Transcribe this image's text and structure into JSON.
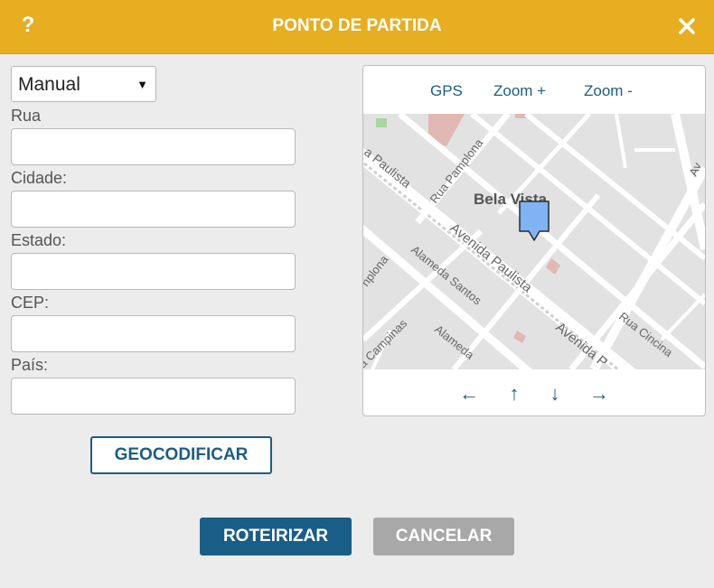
{
  "dialog": {
    "title": "PONTO DE PARTIDA",
    "help_symbol": "?"
  },
  "form": {
    "mode_select": {
      "value": "Manual"
    },
    "fields": {
      "street": {
        "label": "Rua",
        "value": ""
      },
      "city": {
        "label": "Cidade:",
        "value": ""
      },
      "state": {
        "label": "Estado:",
        "value": ""
      },
      "zip": {
        "label": "CEP:",
        "value": ""
      },
      "country": {
        "label": "País:",
        "value": ""
      }
    },
    "geocode_label": "GEOCODIFICAR"
  },
  "map": {
    "controls": {
      "gps": "GPS",
      "zoom_in": "Zoom +",
      "zoom_out": "Zoom -"
    },
    "arrows": {
      "left": "←",
      "up": "↑",
      "down": "↓",
      "right": "→"
    },
    "labels": {
      "district": "Bela Vista",
      "av_paulista_1": "Avenida Paulista",
      "av_paulista_2": "Avenida P",
      "paulista_left": "a Paulista",
      "rua_pamplona": "Rua Pamplona",
      "pamplona_left": "nplona",
      "alameda_santos": "Alameda Santos",
      "alameda_bottom": "Alameda",
      "campinas": "a Campinas",
      "rua_cincinato": "Rua Cincina",
      "right_edge_a": "Av"
    },
    "colors": {
      "pin": "#7fb3f4",
      "road": "#ffffff",
      "block": "#e2e2e2",
      "building": "#e1b6b1"
    }
  },
  "actions": {
    "submit": "ROTEIRIZAR",
    "cancel": "CANCELAR"
  }
}
